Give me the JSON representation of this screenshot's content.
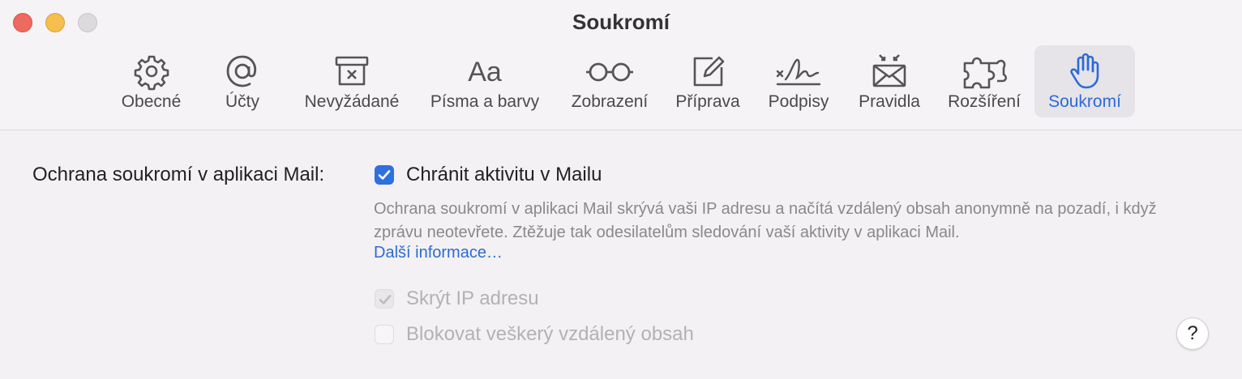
{
  "window": {
    "title": "Soukromí"
  },
  "toolbar": {
    "tabs": [
      {
        "label": "Obecné",
        "icon": "gear-icon"
      },
      {
        "label": "Účty",
        "icon": "at-sign-icon"
      },
      {
        "label": "Nevyžádané",
        "icon": "junk-trash-icon"
      },
      {
        "label": "Písma a barvy",
        "icon": "fonts-icon",
        "glyph": "Aa"
      },
      {
        "label": "Zobrazení",
        "icon": "glasses-icon"
      },
      {
        "label": "Příprava",
        "icon": "compose-icon"
      },
      {
        "label": "Podpisy",
        "icon": "signature-icon"
      },
      {
        "label": "Pravidla",
        "icon": "rules-envelope-icon"
      },
      {
        "label": "Rozšíření",
        "icon": "puzzle-icon"
      },
      {
        "label": "Soukromí",
        "icon": "hand-icon",
        "selected": true
      }
    ]
  },
  "privacy": {
    "section_label": "Ochrana soukromí v aplikaci Mail:",
    "protect_activity": {
      "label": "Chránit aktivitu v Mailu",
      "checked": true
    },
    "description": "Ochrana soukromí v aplikaci Mail skrývá vaši IP adresu a načítá vzdálený obsah anonymně na pozadí, i když zprávu neotevřete. Ztěžuje tak odesilatelům sledování vaší aktivity v aplikaci Mail.",
    "learn_more": "Další informace…",
    "hide_ip": {
      "label": "Skrýt IP adresu",
      "checked": true,
      "disabled": true
    },
    "block_remote": {
      "label": "Blokovat veškerý vzdálený obsah",
      "checked": false,
      "disabled": true
    }
  },
  "help": {
    "label": "?"
  },
  "colors": {
    "accent": "#2c6bd6",
    "checkbox": "#2f6fe0",
    "close": "#ed6a5e",
    "minimize": "#f5be4f",
    "zoom": "#dcdadc"
  }
}
